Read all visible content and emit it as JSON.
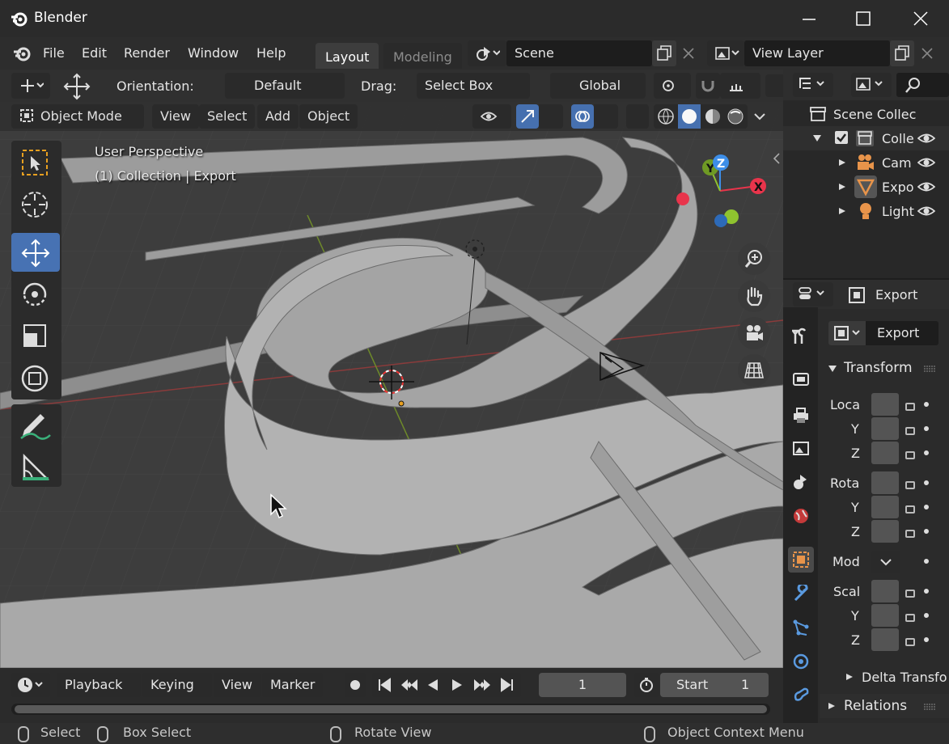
{
  "title": "Blender",
  "menu": [
    "File",
    "Edit",
    "Render",
    "Window",
    "Help"
  ],
  "workspaces": {
    "active": "Layout",
    "other": "Modeling"
  },
  "scene": "Scene",
  "view_layer": "View Layer",
  "header1": {
    "orientation_label": "Orientation:",
    "orientation_value": "Default",
    "drag_label": "Drag:",
    "drag_value": "Select Box",
    "transform_space": "Global"
  },
  "header2": {
    "mode": "Object Mode",
    "view": "View",
    "select": "Select",
    "add": "Add",
    "object": "Object"
  },
  "viewport": {
    "line1": "User Perspective",
    "line2": "(1) Collection | Export"
  },
  "gizmo": {
    "x": "X",
    "y": "Y",
    "z": "Z"
  },
  "outliner": {
    "scene_collection": "Scene Collec",
    "items": [
      {
        "label": "Colle"
      },
      {
        "label": "Cam"
      },
      {
        "label": "Expo"
      },
      {
        "label": "Light"
      }
    ]
  },
  "properties": {
    "object_name": "Export",
    "object_field": "Export",
    "transform_title": "Transform",
    "location": "Loca",
    "rotation": "Rota",
    "mode": "Mod",
    "scale": "Scal",
    "y": "Y",
    "z": "Z",
    "delta": "Delta Transfo",
    "relations": "Relations"
  },
  "timeline": {
    "playback": "Playback",
    "keying": "Keying",
    "view": "View",
    "marker": "Marker",
    "frame": "1",
    "start_label": "Start",
    "start_value": "1"
  },
  "status": {
    "select": "Select",
    "box_select": "Box Select",
    "rotate_view": "Rotate View",
    "context_menu": "Object Context Menu"
  },
  "colors": {
    "accent": "#4772b3",
    "bg": "#303030",
    "viewport": "#3d3d3d",
    "x_axis": "#e8344b",
    "y_axis": "#8fc32f",
    "z_axis": "#3d8ee8"
  }
}
